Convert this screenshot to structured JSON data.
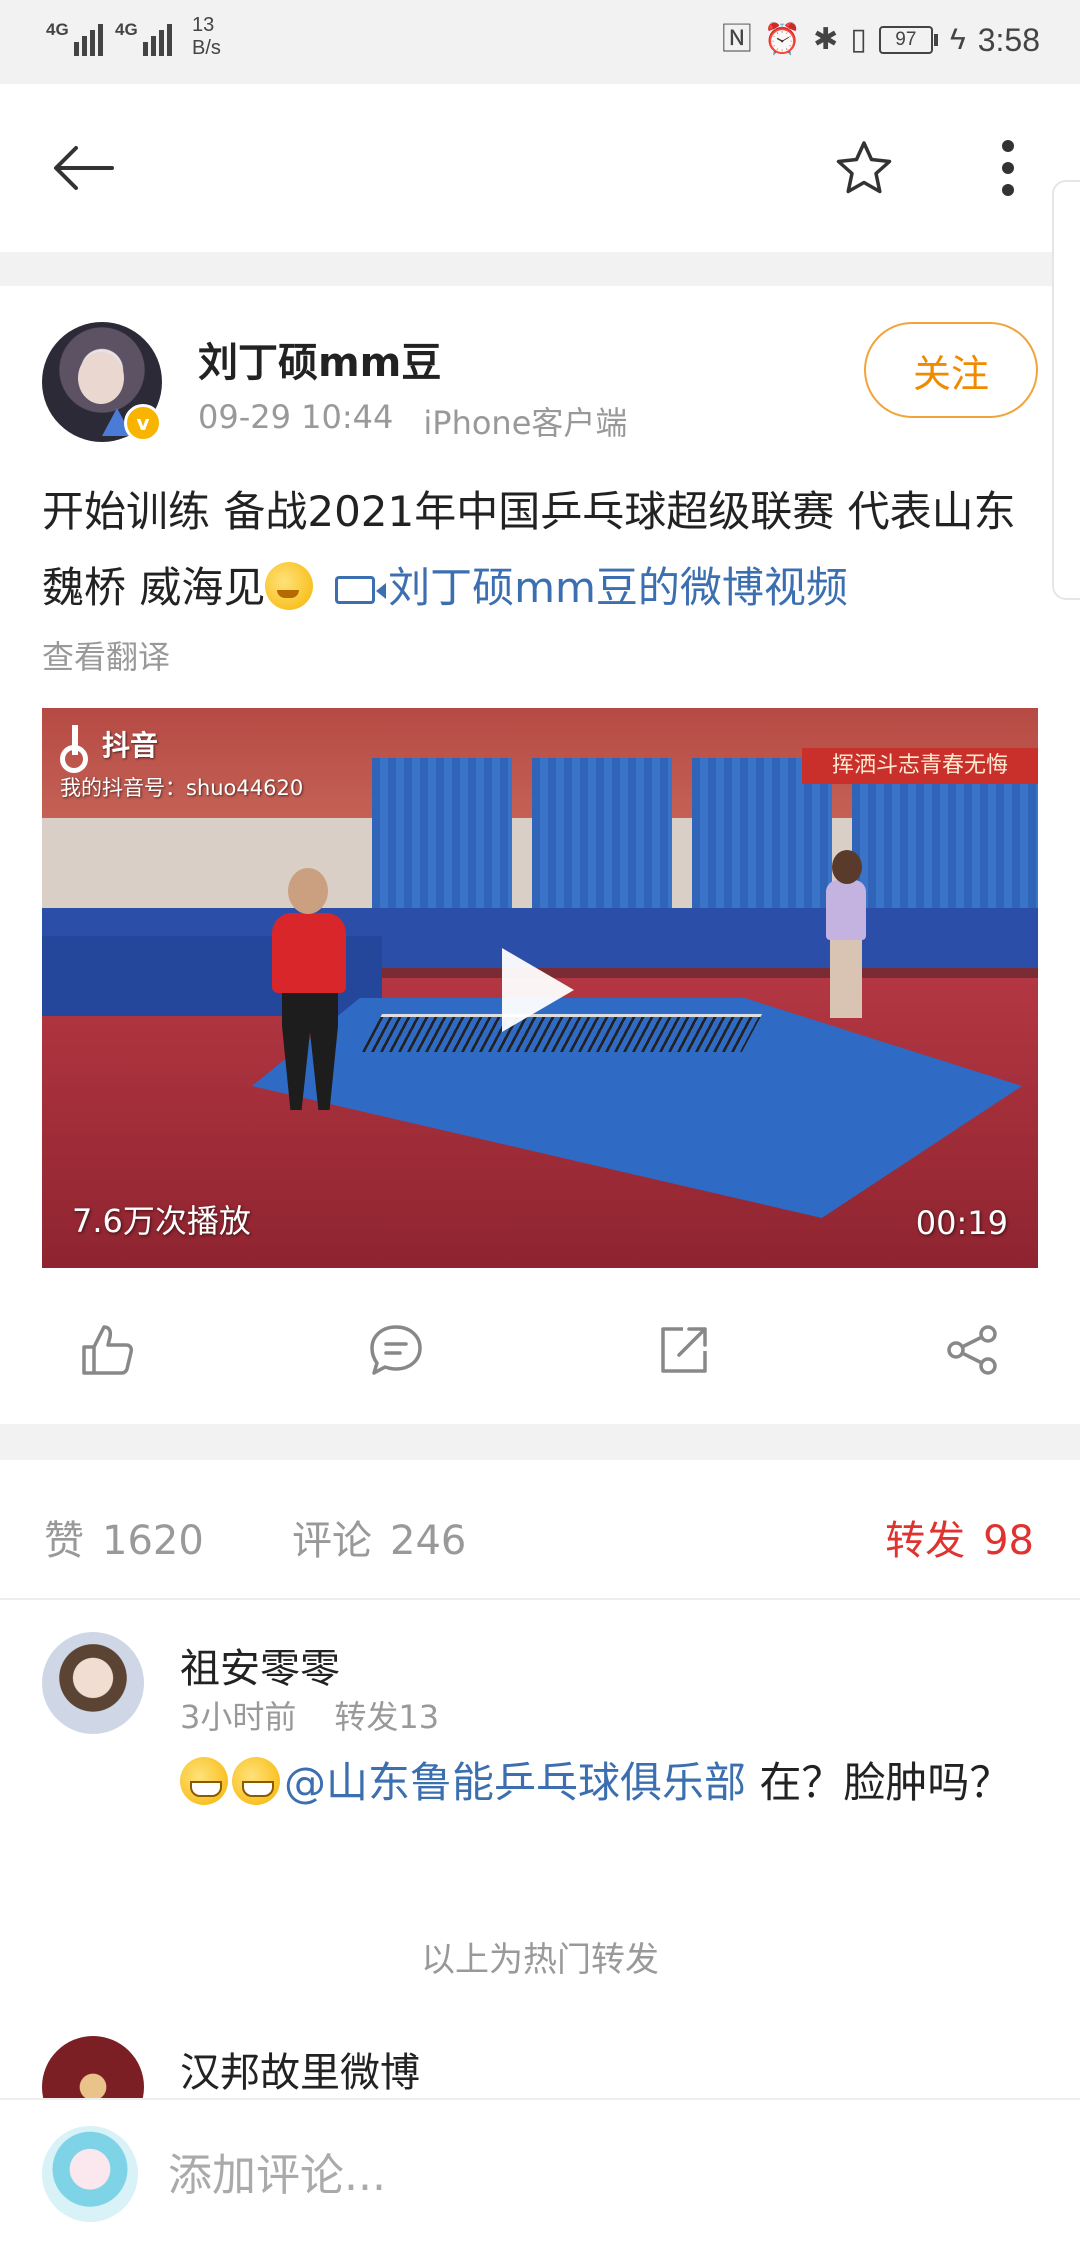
{
  "status_bar": {
    "net1": "4G",
    "net2": "4G",
    "speed_value": "13",
    "speed_unit": "B/s",
    "battery": "97",
    "time": "3:58"
  },
  "post": {
    "author": "刘丁硕mm豆",
    "date": "09-29 10:44",
    "source": "iPhone客户端",
    "follow_label": "关注",
    "text": "开始训练 备战2021年中国乒乓球超级联赛 代表山东魏桥 威海见",
    "video_link": "刘丁硕mm豆的微博视频",
    "translate_label": "查看翻译",
    "video": {
      "watermark_brand": "抖音",
      "watermark_id": "我的抖音号：shuo44620",
      "banner_text": "挥洒斗志青春无悔",
      "views": "7.6万次播放",
      "duration": "00:19"
    }
  },
  "stats": {
    "likes_label": "赞",
    "likes_count": "1620",
    "comments_label": "评论",
    "comments_count": "246",
    "reposts_label": "转发",
    "reposts_count": "98"
  },
  "reposts": [
    {
      "name": "祖安零零",
      "time": "3小时前",
      "reposts": "转发13",
      "mention": "@山东鲁能乒乓球俱乐部",
      "text": " 在？脸肿吗？"
    },
    {
      "name": "汉邦故里微博"
    }
  ],
  "hot_note": "以上为热门转发",
  "input": {
    "placeholder": "添加评论..."
  },
  "colors": {
    "accent_orange": "#f08a00",
    "link_blue": "#3c6fb0",
    "active_red": "#e0322f"
  }
}
